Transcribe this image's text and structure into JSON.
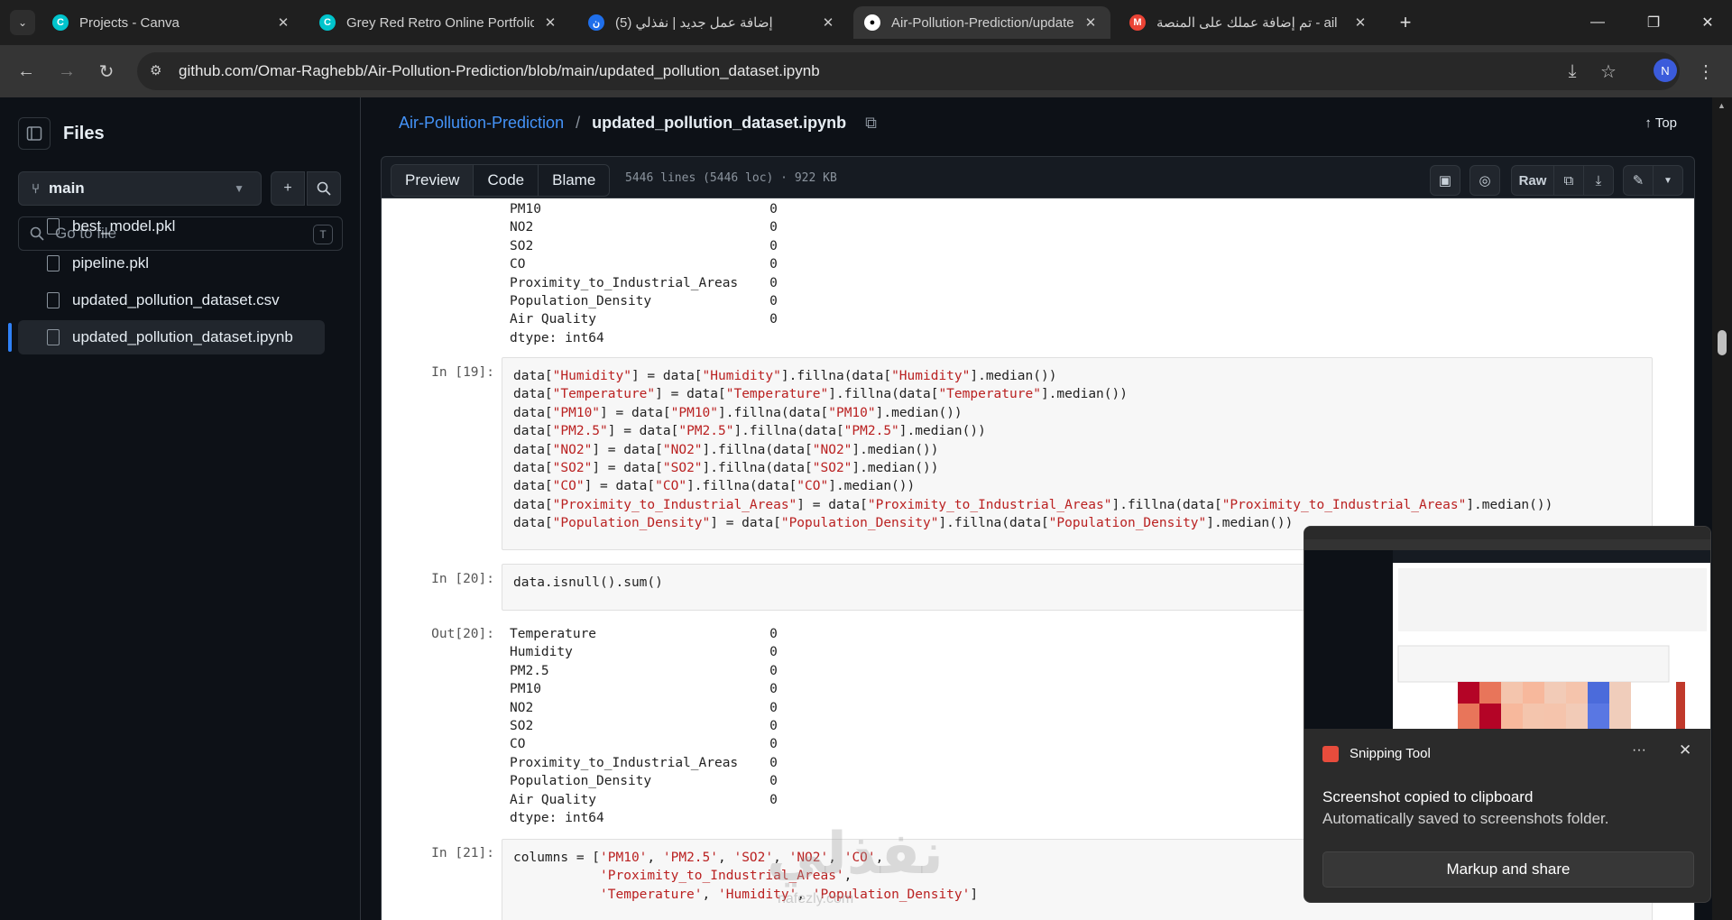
{
  "browser": {
    "tabs": [
      {
        "title": "Projects - Canva",
        "fav_color": "#00c4cc",
        "fav_glyph": "C"
      },
      {
        "title": "Grey Red Retro Online Portfolio",
        "fav_color": "#00c4cc",
        "fav_glyph": "C"
      },
      {
        "title": "(5) إضافة عمل جديد | نفذلي",
        "fav_color": "#1f6feb",
        "fav_glyph": "ن"
      },
      {
        "title": "Air-Pollution-Prediction/update",
        "fav_color": "#ffffff",
        "fav_glyph": "●"
      },
      {
        "title": "تم إضافة عملك على المنصة - ail",
        "fav_color": "#ea4335",
        "fav_glyph": "M"
      }
    ],
    "new_tab": "+",
    "url": "github.com/Omar-Raghebb/Air-Pollution-Prediction/blob/main/updated_pollution_dataset.ipynb",
    "avatar_letter": "N"
  },
  "sidebar": {
    "title": "Files",
    "branch": "main",
    "goto_placeholder": "Go to file",
    "goto_shortcut": "T",
    "files": [
      "best_model.pkl",
      "pipeline.pkl",
      "updated_pollution_dataset.csv",
      "updated_pollution_dataset.ipynb"
    ],
    "selected_file": "updated_pollution_dataset.ipynb"
  },
  "header": {
    "repo": "Air-Pollution-Prediction",
    "sep": "/",
    "file": "updated_pollution_dataset.ipynb",
    "top_label": "Top",
    "tabs": {
      "preview": "Preview",
      "code": "Code",
      "blame": "Blame"
    },
    "file_meta": "5446 lines (5446 loc) · 922 KB",
    "raw_label": "Raw"
  },
  "notebook": {
    "out_prev": [
      "PM10                             0",
      "NO2                              0",
      "SO2                              0",
      "CO                               0",
      "Proximity_to_Industrial_Areas    0",
      "Population_Density               0",
      "Air Quality                      0",
      "dtype: int64"
    ],
    "in19_label": "In [19]:",
    "in19_lines": [
      "data[\"Humidity\"] = data[\"Humidity\"].fillna(data[\"Humidity\"].median())",
      "data[\"Temperature\"] = data[\"Temperature\"].fillna(data[\"Temperature\"].median())",
      "data[\"PM10\"] = data[\"PM10\"].fillna(data[\"PM10\"].median())",
      "data[\"PM2.5\"] = data[\"PM2.5\"].fillna(data[\"PM2.5\"].median())",
      "data[\"NO2\"] = data[\"NO2\"].fillna(data[\"NO2\"].median())",
      "data[\"SO2\"] = data[\"SO2\"].fillna(data[\"SO2\"].median())",
      "data[\"CO\"] = data[\"CO\"].fillna(data[\"CO\"].median())",
      "data[\"Proximity_to_Industrial_Areas\"] = data[\"Proximity_to_Industrial_Areas\"].fillna(data[\"Proximity_to_Industrial_Areas\"].median())",
      "data[\"Population_Density\"] = data[\"Population_Density\"].fillna(data[\"Population_Density\"].median())"
    ],
    "in20_label": "In [20]:",
    "in20_code": "data.isnull().sum()",
    "out20_label": "Out[20]:",
    "out20_lines": [
      "Temperature                      0",
      "Humidity                         0",
      "PM2.5                            0",
      "PM10                             0",
      "NO2                              0",
      "SO2                              0",
      "CO                               0",
      "Proximity_to_Industrial_Areas    0",
      "Population_Density               0",
      "Air Quality                      0",
      "dtype: int64"
    ],
    "in21_label": "In [21]:",
    "in21_lines": [
      "columns = ['PM10', 'PM2.5', 'SO2', 'NO2', 'CO',",
      "           'Proximity_to_Industrial_Areas',",
      "           'Temperature', 'Humidity', 'Population_Density']"
    ]
  },
  "watermark": {
    "ar": "نفذلي",
    "en": "nafezly.com"
  },
  "snipping": {
    "app": "Snipping Tool",
    "more": "···",
    "message": "Screenshot copied to clipboard",
    "sub": "Automatically saved to screenshots folder.",
    "button": "Markup and share"
  }
}
